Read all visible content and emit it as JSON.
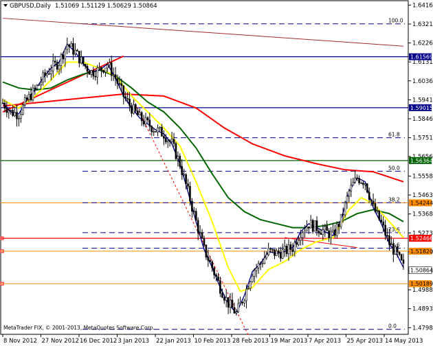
{
  "header": {
    "symbol": "GBPUSD,Daily",
    "ohlc": "1.51069 1.51129 1.50629 1.50864"
  },
  "footer": {
    "copyright": "MetaTrader FIX, © 2001-2013, MetaQuotes Software Corp."
  },
  "colors": {
    "candle": "#000000",
    "ma_fast_blue": "#00008b",
    "ma_yellow": "#ffff00",
    "ma_green": "#006400",
    "ma_red": "#ff0000",
    "trend_red": "#ff0000",
    "trend_brown": "#a52a2a",
    "hl_navy": "#00008b",
    "hl_green": "#006400",
    "hl_red": "#ff0000",
    "fib_dashed": "#00008b",
    "support_orange": "#ff8c00"
  },
  "chart_data": {
    "type": "candlestick",
    "title": "GBPUSD,Daily",
    "ylim": [
      1.4765,
      1.6438
    ],
    "y_ticks": [
      "1.64160",
      "1.63210",
      "1.62260",
      "1.61310",
      "1.60360",
      "1.59410",
      "1.58460",
      "1.57510",
      "1.56565",
      "1.55585",
      "1.54635",
      "1.53685",
      "1.52735",
      "1.51785",
      "1.50835",
      "1.49885",
      "1.48935",
      "1.47985"
    ],
    "x_ticks": [
      "8 Nov 2012",
      "27 Nov 2012",
      "16 Dec 2012",
      "3 Jan 2013",
      "22 Jan 2013",
      "10 Feb 2013",
      "28 Feb 2013",
      "19 Mar 2013",
      "7 Apr 2013",
      "25 Apr 2013",
      "14 May 2013"
    ],
    "horizontal_lines": [
      {
        "price": 1.61569,
        "label": "1.61569",
        "style": "solid",
        "color": "navy"
      },
      {
        "price": 1.59015,
        "label": "1.59015",
        "style": "solid",
        "color": "navy"
      },
      {
        "price": 1.56364,
        "label": "1.56364",
        "style": "solid",
        "color": "green"
      },
      {
        "price": 1.54244,
        "label": "1.54244",
        "style": "solid",
        "color": "orange"
      },
      {
        "price": 1.52466,
        "label": "1.52466",
        "style": "solid",
        "color": "red"
      },
      {
        "price": 1.5182,
        "label": "1.51820",
        "style": "solid",
        "color": "orange"
      },
      {
        "price": 1.50864,
        "label": "1.50864",
        "style": "solid",
        "color": "white"
      },
      {
        "price": 1.50189,
        "label": "1.50189",
        "style": "solid",
        "color": "orange"
      }
    ],
    "fibonacci_levels": [
      {
        "label": "100.0",
        "price": 1.6322
      },
      {
        "label": "61.8",
        "price": 1.5751
      },
      {
        "label": "50.0",
        "price": 1.5583
      },
      {
        "label": "38.2",
        "price": 1.5425
      },
      {
        "label": "23.6",
        "price": 1.5275
      },
      {
        "label": "23.6",
        "price": 1.5197
      },
      {
        "label": "0.0",
        "price": 1.479
      }
    ],
    "series": [
      {
        "kind": "ma",
        "color": "blue",
        "points": [
          [
            0,
            1.5925
          ],
          [
            4,
            1.588
          ],
          [
            8,
            1.587
          ],
          [
            12,
            1.594
          ],
          [
            16,
            1.599
          ],
          [
            20,
            1.605
          ],
          [
            24,
            1.61
          ],
          [
            28,
            1.613
          ],
          [
            32,
            1.622
          ],
          [
            36,
            1.618
          ],
          [
            40,
            1.612
          ],
          [
            44,
            1.608
          ],
          [
            48,
            1.609
          ],
          [
            52,
            1.612
          ],
          [
            56,
            1.605
          ],
          [
            60,
            1.596
          ],
          [
            64,
            1.59
          ],
          [
            68,
            1.585
          ],
          [
            72,
            1.582
          ],
          [
            76,
            1.579
          ],
          [
            80,
            1.577
          ],
          [
            84,
            1.572
          ],
          [
            88,
            1.562
          ],
          [
            92,
            1.548
          ],
          [
            96,
            1.533
          ],
          [
            100,
            1.519
          ],
          [
            104,
            1.51
          ],
          [
            108,
            1.5
          ],
          [
            112,
            1.492
          ],
          [
            116,
            1.487
          ],
          [
            120,
            1.496
          ],
          [
            124,
            1.508
          ],
          [
            128,
            1.512
          ],
          [
            132,
            1.518
          ],
          [
            136,
            1.517
          ],
          [
            140,
            1.518
          ],
          [
            144,
            1.52
          ],
          [
            148,
            1.528
          ],
          [
            152,
            1.532
          ],
          [
            156,
            1.53
          ],
          [
            160,
            1.528
          ],
          [
            164,
            1.526
          ],
          [
            168,
            1.534
          ],
          [
            172,
            1.548
          ],
          [
            176,
            1.555
          ],
          [
            180,
            1.553
          ],
          [
            184,
            1.54
          ],
          [
            188,
            1.532
          ],
          [
            192,
            1.522
          ],
          [
            196,
            1.516
          ],
          [
            199,
            1.51
          ]
        ]
      },
      {
        "kind": "ma",
        "color": "yellow",
        "points": [
          [
            0,
            1.594
          ],
          [
            8,
            1.59
          ],
          [
            16,
            1.596
          ],
          [
            24,
            1.604
          ],
          [
            32,
            1.613
          ],
          [
            40,
            1.613
          ],
          [
            48,
            1.61
          ],
          [
            56,
            1.606
          ],
          [
            64,
            1.596
          ],
          [
            72,
            1.588
          ],
          [
            80,
            1.58
          ],
          [
            88,
            1.571
          ],
          [
            96,
            1.553
          ],
          [
            104,
            1.533
          ],
          [
            112,
            1.51
          ],
          [
            118,
            1.498
          ],
          [
            124,
            1.5
          ],
          [
            132,
            1.509
          ],
          [
            140,
            1.513
          ],
          [
            148,
            1.519
          ],
          [
            156,
            1.523
          ],
          [
            164,
            1.525
          ],
          [
            172,
            1.539
          ],
          [
            178,
            1.545
          ],
          [
            184,
            1.542
          ],
          [
            192,
            1.533
          ],
          [
            199,
            1.525
          ]
        ]
      },
      {
        "kind": "ma",
        "color": "green",
        "points": [
          [
            0,
            1.603
          ],
          [
            8,
            1.6
          ],
          [
            16,
            1.599
          ],
          [
            24,
            1.6
          ],
          [
            32,
            1.604
          ],
          [
            40,
            1.607
          ],
          [
            48,
            1.609
          ],
          [
            56,
            1.606
          ],
          [
            64,
            1.6
          ],
          [
            72,
            1.593
          ],
          [
            80,
            1.588
          ],
          [
            88,
            1.58
          ],
          [
            96,
            1.57
          ],
          [
            104,
            1.557
          ],
          [
            112,
            1.545
          ],
          [
            120,
            1.538
          ],
          [
            128,
            1.534
          ],
          [
            136,
            1.532
          ],
          [
            144,
            1.53
          ],
          [
            152,
            1.53
          ],
          [
            160,
            1.531
          ],
          [
            168,
            1.533
          ],
          [
            176,
            1.537
          ],
          [
            184,
            1.539
          ],
          [
            192,
            1.537
          ],
          [
            199,
            1.533
          ]
        ]
      },
      {
        "kind": "ma",
        "color": "red",
        "points": [
          [
            0,
            1.591
          ],
          [
            20,
            1.593
          ],
          [
            40,
            1.595
          ],
          [
            60,
            1.597
          ],
          [
            80,
            1.596
          ],
          [
            96,
            1.59
          ],
          [
            110,
            1.58
          ],
          [
            124,
            1.572
          ],
          [
            140,
            1.566
          ],
          [
            156,
            1.562
          ],
          [
            170,
            1.559
          ],
          [
            184,
            1.558
          ],
          [
            199,
            1.553
          ]
        ]
      }
    ],
    "trendlines": [
      {
        "color": "red",
        "from": [
          0,
          1.588
        ],
        "to": [
          60,
          1.616
        ],
        "width": 2
      },
      {
        "color": "brown",
        "from": [
          0,
          1.635
        ],
        "to": [
          199,
          1.621
        ],
        "width": 1
      },
      {
        "color": "red",
        "from": [
          64,
          1.596
        ],
        "to": [
          122,
          1.476
        ],
        "dash": true
      },
      {
        "color": "red",
        "from": [
          140,
          1.525
        ],
        "to": [
          176,
          1.52
        ],
        "width": 1
      }
    ]
  }
}
